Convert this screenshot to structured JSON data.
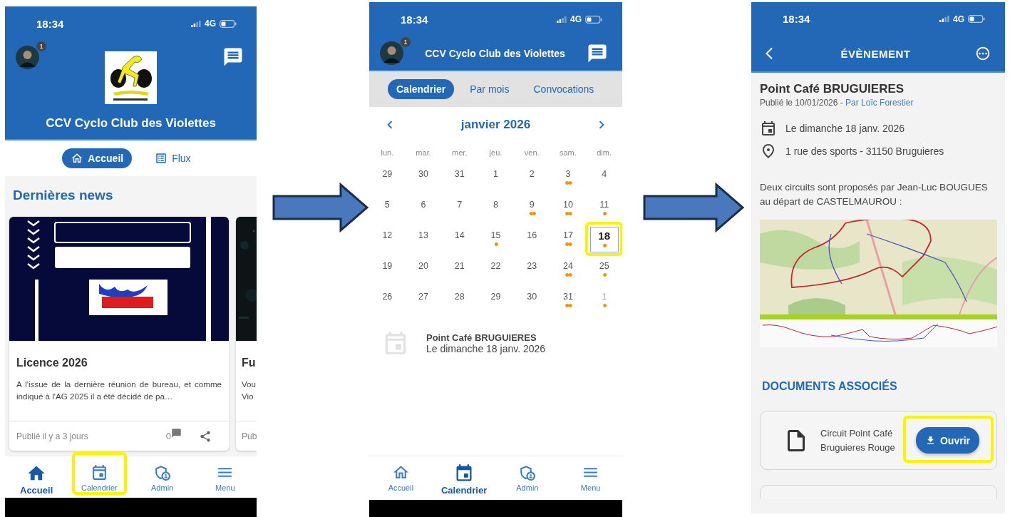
{
  "home_screen": {
    "status_bar": {
      "time": "18:34",
      "network": "4G"
    },
    "notification_count": "1",
    "club_name": "CCV Cyclo Club des Violettes",
    "tabs": [
      {
        "label": "Accueil",
        "selected": true
      },
      {
        "label": "Flux",
        "selected": false
      }
    ],
    "section_title": "Dernières news",
    "news_cards": [
      {
        "title": "Licence 2026",
        "excerpt": "A l'issue de la dernière réunion de bureau, et comme indiqué à l'AG 2025 il a été décidé de pa…",
        "published": "Publié il y a 3 jours",
        "comment_count": "0"
      },
      {
        "title": "Fu",
        "excerpt_lines": [
          "Vou",
          "Vio"
        ],
        "published": "Pub"
      }
    ],
    "bottom_nav": [
      {
        "label": "Accueil",
        "selected": true,
        "highlighted": false
      },
      {
        "label": "Calendrier",
        "selected": false,
        "highlighted": true
      },
      {
        "label": "Admin",
        "selected": false,
        "highlighted": false
      },
      {
        "label": "Menu",
        "selected": false,
        "highlighted": false
      }
    ]
  },
  "calendar_screen": {
    "status_bar": {
      "time": "18:34",
      "network": "4G"
    },
    "notification_count": "1",
    "club_name": "CCV Cyclo Club des Violettes",
    "tabs": [
      {
        "label": "Calendrier",
        "selected": true
      },
      {
        "label": "Par mois",
        "selected": false
      },
      {
        "label": "Convocations",
        "selected": false
      }
    ],
    "month": "janvier 2026",
    "weekdays": [
      "lun.",
      "mar.",
      "mer.",
      "jeu.",
      "ven.",
      "sam.",
      "dim."
    ],
    "days": [
      {
        "day": "29",
        "other_month": false,
        "selected": false,
        "highlighted": false
      },
      {
        "day": "30",
        "other_month": false,
        "selected": false,
        "highlighted": false
      },
      {
        "day": "31",
        "other_month": false,
        "selected": false,
        "highlighted": false
      },
      {
        "day": "1",
        "other_month": false,
        "selected": false,
        "highlighted": false
      },
      {
        "day": "2",
        "other_month": false,
        "selected": false,
        "highlighted": false
      },
      {
        "day": "3",
        "marks": "••",
        "other_month": false,
        "selected": false,
        "highlighted": false
      },
      {
        "day": "4",
        "other_month": false,
        "selected": false,
        "highlighted": false
      },
      {
        "day": "5",
        "other_month": false,
        "selected": false,
        "highlighted": false
      },
      {
        "day": "6",
        "other_month": false,
        "selected": false,
        "highlighted": false
      },
      {
        "day": "7",
        "other_month": false,
        "selected": false,
        "highlighted": false
      },
      {
        "day": "8",
        "other_month": false,
        "selected": false,
        "highlighted": false
      },
      {
        "day": "9",
        "marks": "••",
        "other_month": false,
        "selected": false,
        "highlighted": false
      },
      {
        "day": "10",
        "marks": "••",
        "other_month": false,
        "selected": false,
        "highlighted": false
      },
      {
        "day": "11",
        "marks": "•",
        "other_month": false,
        "selected": false,
        "highlighted": false
      },
      {
        "day": "12",
        "other_month": false,
        "selected": false,
        "highlighted": false
      },
      {
        "day": "13",
        "other_month": false,
        "selected": false,
        "highlighted": false
      },
      {
        "day": "14",
        "other_month": false,
        "selected": false,
        "highlighted": false
      },
      {
        "day": "15",
        "marks": "•",
        "other_month": false,
        "selected": false,
        "highlighted": false
      },
      {
        "day": "16",
        "other_month": false,
        "selected": false,
        "highlighted": false
      },
      {
        "day": "17",
        "marks": "••",
        "other_month": false,
        "selected": false,
        "highlighted": false
      },
      {
        "day": "18",
        "marks": "•",
        "other_month": false,
        "selected": true,
        "highlighted": true
      },
      {
        "day": "19",
        "other_month": false,
        "selected": false,
        "highlighted": false
      },
      {
        "day": "20",
        "other_month": false,
        "selected": false,
        "highlighted": false
      },
      {
        "day": "21",
        "other_month": false,
        "selected": false,
        "highlighted": false
      },
      {
        "day": "22",
        "other_month": false,
        "selected": false,
        "highlighted": false
      },
      {
        "day": "23",
        "other_month": false,
        "selected": false,
        "highlighted": false
      },
      {
        "day": "24",
        "marks": "••",
        "other_month": false,
        "selected": false,
        "highlighted": false
      },
      {
        "day": "25",
        "marks": "•",
        "other_month": false,
        "selected": false,
        "highlighted": false
      },
      {
        "day": "26",
        "other_month": false,
        "selected": false,
        "highlighted": false
      },
      {
        "day": "27",
        "other_month": false,
        "selected": false,
        "highlighted": false
      },
      {
        "day": "28",
        "other_month": false,
        "selected": false,
        "highlighted": false
      },
      {
        "day": "29",
        "other_month": false,
        "selected": false,
        "highlighted": false
      },
      {
        "day": "30",
        "other_month": false,
        "selected": false,
        "highlighted": false
      },
      {
        "day": "31",
        "marks": "••",
        "other_month": false,
        "selected": false,
        "highlighted": false
      },
      {
        "day": "1",
        "marks": "•",
        "other_month": true,
        "selected": false,
        "highlighted": false
      }
    ],
    "event": {
      "title": "Point Café BRUGUIERES",
      "date": "Le dimanche 18 janv. 2026"
    },
    "bottom_nav": [
      {
        "label": "Accueil",
        "selected": false,
        "highlighted": false
      },
      {
        "label": "Calendrier",
        "selected": true,
        "highlighted": false
      },
      {
        "label": "Admin",
        "selected": false,
        "highlighted": false
      },
      {
        "label": "Menu",
        "selected": false,
        "highlighted": false
      }
    ]
  },
  "event_screen": {
    "status_bar": {
      "time": "18:34",
      "network": "4G"
    },
    "title": "ÉVÈNEMENT",
    "event_title": "Point Café BRUGUIERES",
    "published": "Publié le 10/01/2026 - ",
    "author": "Par Loïc Forestier",
    "date": "Le dimanche 18 janv. 2026",
    "address": "1 rue des sports - 31150 Bruguieres",
    "description": "Deux circuits sont proposés par Jean-Luc BOUGUES au départ de CASTELMAUROU :",
    "documents_title": "DOCUMENTS ASSOCIÉS",
    "documents": [
      {
        "name": "Circuit Point Café Bruguieres Rouge",
        "action": "Ouvrir",
        "highlighted": true
      }
    ]
  }
}
